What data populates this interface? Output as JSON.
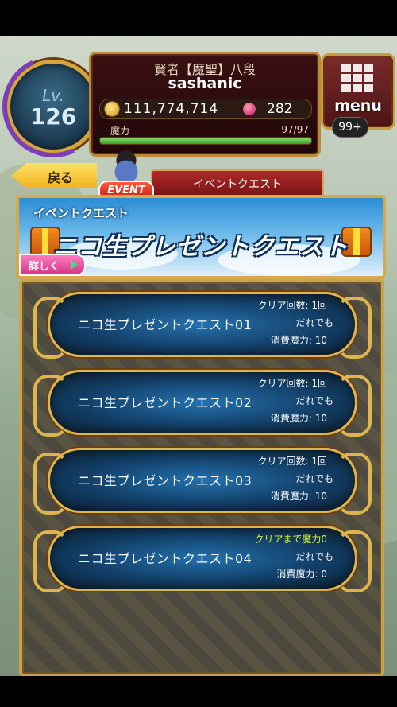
{
  "player": {
    "level_label": "Lv.",
    "level": "126",
    "title": "賢者【魔聖】八段",
    "name": "sashanic",
    "gold": "111,774,714",
    "gems": "282",
    "mana_label": "魔力",
    "mana_value": "97/97",
    "mana_fraction": 1.0
  },
  "menu": {
    "label": "menu",
    "notification_count": "99+"
  },
  "nav": {
    "back_label": "戻る",
    "event_badge": "EVENT",
    "title": "イベントクエスト"
  },
  "banner": {
    "category": "イベントクエスト",
    "title": "ニコ生プレゼントクエスト",
    "details_label": "詳しく"
  },
  "quests": [
    {
      "name": "ニコ生プレゼントクエスト01",
      "status": "クリア回数: 1回",
      "who": "だれでも",
      "cost": "消費魔力: 10",
      "highlight": false
    },
    {
      "name": "ニコ生プレゼントクエスト02",
      "status": "クリア回数: 1回",
      "who": "だれでも",
      "cost": "消費魔力: 10",
      "highlight": false
    },
    {
      "name": "ニコ生プレゼントクエスト03",
      "status": "クリア回数: 1回",
      "who": "だれでも",
      "cost": "消費魔力: 10",
      "highlight": false
    },
    {
      "name": "ニコ生プレゼントクエスト04",
      "status": "クリアまで魔力0",
      "who": "だれでも",
      "cost": "消費魔力: 0",
      "highlight": true
    }
  ],
  "colors": {
    "gold_frame": "#e2b64a",
    "quest_blue": "#0c3a66",
    "highlight_status": "#d9f53a"
  }
}
